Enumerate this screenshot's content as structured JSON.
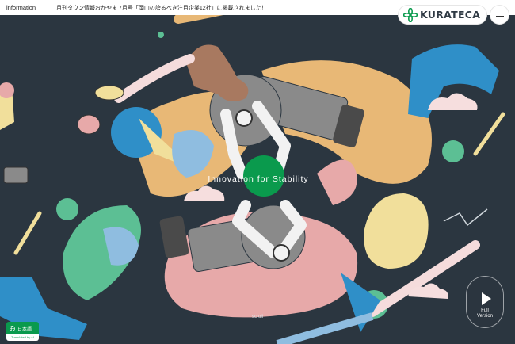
{
  "topbar": {
    "info_label": "information",
    "news_text": "月刊タウン情報おかやま 7月号「岡山の誇るべき注目企業12社」に掲載されました！"
  },
  "brand": {
    "name": "KURATECA",
    "logo_icon": "flower-logo-icon",
    "color": "#0a9a4d"
  },
  "menu": {
    "icon": "hamburger-menu-icon"
  },
  "hero": {
    "tagline": "Innovation for Stability",
    "scroll_label": "scroll"
  },
  "language": {
    "label": "日本語",
    "icon": "globe-icon",
    "note": "Translated by AI"
  },
  "video": {
    "label_line1": "Full",
    "label_line2": "Version",
    "icon": "play-icon"
  },
  "colors": {
    "background": "#2b3640",
    "accent_green": "#0a9a4d",
    "orange": "#e8b876",
    "pink": "#e7a9a9",
    "blue": "#2f8fc8",
    "gray": "#8a8a8a"
  }
}
